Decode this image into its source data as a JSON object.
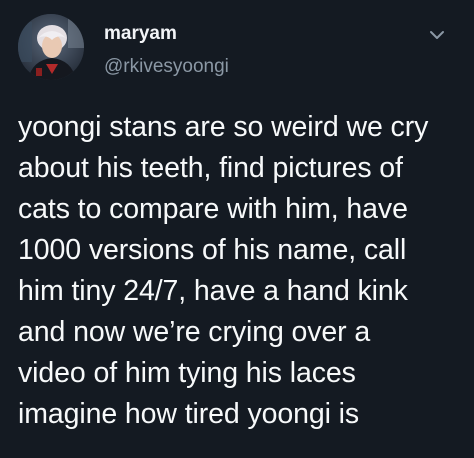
{
  "tweet": {
    "display_name": "maryam",
    "handle": "@rkivesyoongi",
    "text_lines": [
      "yoongi stans are so weird we cry",
      "about his teeth, find pictures of",
      "cats to compare with him, have",
      "1000 versions of his name, call",
      "him tiny 24/7, have a hand kink",
      "and now we’re crying over a",
      "video of him tying his laces",
      "imagine how tired yoongi is"
    ]
  },
  "icons": {
    "more": "chevron-down-icon",
    "avatar": "avatar-photo"
  },
  "colors": {
    "background": "#141a22",
    "text_primary": "#f7f9fa",
    "text_secondary": "#8b98a5"
  }
}
